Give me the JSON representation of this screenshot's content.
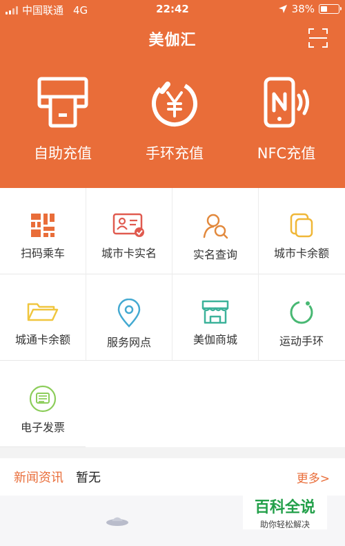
{
  "status_bar": {
    "carrier": "中国联通",
    "network": "4G",
    "time": "22:42",
    "battery": "38%",
    "icons": [
      "signal-icon",
      "location-arrow-icon",
      "battery-icon"
    ]
  },
  "header": {
    "title": "美伽汇",
    "scan_icon": "scan-icon",
    "actions": [
      {
        "label": "自助充值",
        "icon": "self-recharge-icon"
      },
      {
        "label": "手环充值",
        "icon": "yuan-circle-icon"
      },
      {
        "label": "NFC充值",
        "icon": "nfc-phone-icon"
      }
    ]
  },
  "grid": {
    "items": [
      {
        "label": "扫码乘车",
        "icon": "qr-code-icon",
        "color": "#e96d39"
      },
      {
        "label": "城市卡实名",
        "icon": "id-card-icon",
        "color": "#e05a4f"
      },
      {
        "label": "实名查询",
        "icon": "person-search-icon",
        "color": "#e2893d"
      },
      {
        "label": "城市卡余额",
        "icon": "card-stack-icon",
        "color": "#f0b737"
      },
      {
        "label": "城通卡余额",
        "icon": "folder-icon",
        "color": "#f0c63e"
      },
      {
        "label": "服务网点",
        "icon": "location-pin-icon",
        "color": "#43a9d1"
      },
      {
        "label": "美伽商城",
        "icon": "store-icon",
        "color": "#3cb29a"
      },
      {
        "label": "运动手环",
        "icon": "ring-icon",
        "color": "#48b873"
      },
      {
        "label": "电子发票",
        "icon": "invoice-icon",
        "color": "#8ccd5a"
      }
    ]
  },
  "news": {
    "label": "新闻资讯",
    "message": "暂无",
    "more": "更多>"
  },
  "watermark": {
    "title": "百科全说",
    "subtitle": "助你轻松解决"
  },
  "colors": {
    "header_bg": "#e96d39",
    "accent": "#e96d39",
    "watermark_green": "#23a04a"
  }
}
